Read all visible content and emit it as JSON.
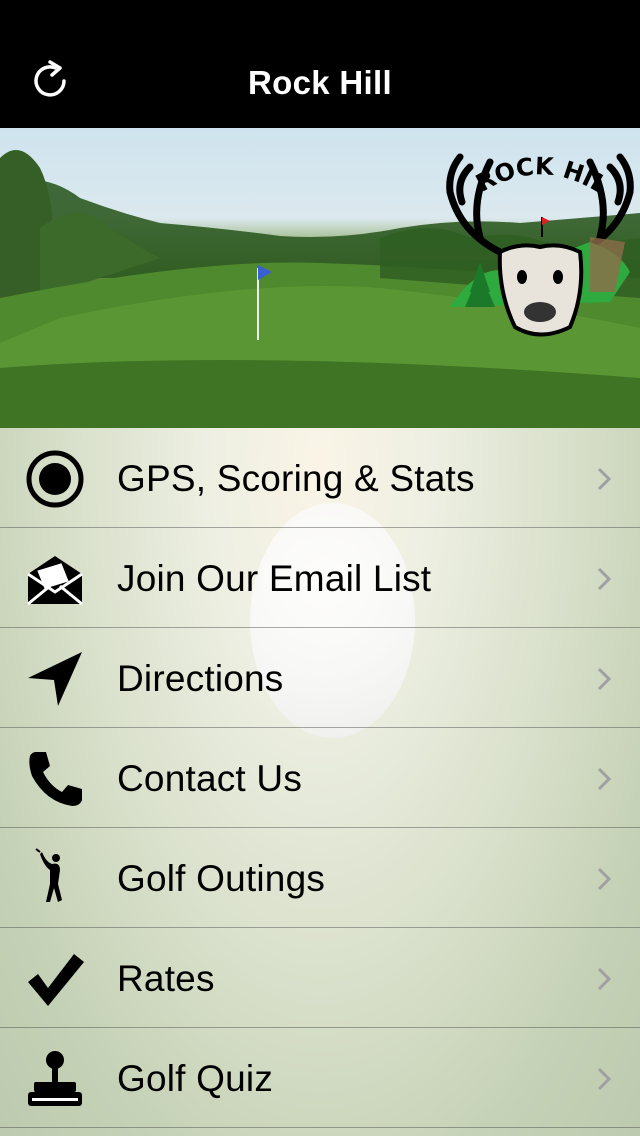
{
  "navbar": {
    "title": "Rock Hill",
    "refresh_icon": "refresh-icon"
  },
  "hero": {
    "logo_text": "ROCK HILL"
  },
  "menu": {
    "items": [
      {
        "label": "GPS, Scoring & Stats",
        "icon": "gps-target-icon"
      },
      {
        "label": "Join Our Email List",
        "icon": "email-envelope-icon"
      },
      {
        "label": "Directions",
        "icon": "navigation-arrow-icon"
      },
      {
        "label": "Contact Us",
        "icon": "phone-icon"
      },
      {
        "label": "Golf Outings",
        "icon": "golfer-icon"
      },
      {
        "label": "Rates",
        "icon": "checkmark-icon"
      },
      {
        "label": "Golf Quiz",
        "icon": "joystick-icon"
      }
    ]
  },
  "colors": {
    "navbar_bg": "#000000",
    "navbar_text": "#ffffff",
    "chevron": "#a0a0a0"
  }
}
